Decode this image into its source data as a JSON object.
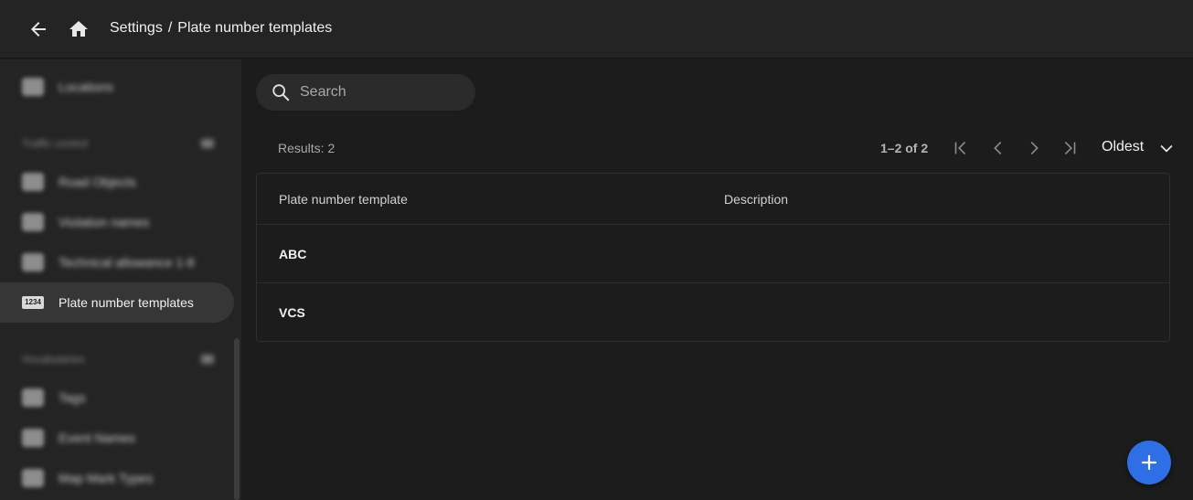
{
  "header": {
    "back_icon": "arrow-left-icon",
    "home_icon": "home-icon",
    "breadcrumb": {
      "parent": "Settings",
      "separator": "/",
      "current": "Plate number templates"
    }
  },
  "sidebar": {
    "items_top": [
      {
        "label": "Locations",
        "icon": "globe-icon"
      }
    ],
    "sections": [
      {
        "title": "Traffic control",
        "items": [
          {
            "label": "Road Objects",
            "icon": "road-object-icon"
          },
          {
            "label": "Violation names",
            "icon": "violation-icon"
          },
          {
            "label": "Technical allowance 1‑8",
            "icon": "allowance-icon"
          },
          {
            "label": "Plate number templates",
            "icon": "plate-icon",
            "active": true,
            "icon_text": "1234"
          }
        ]
      },
      {
        "title": "Vocabularies",
        "items": [
          {
            "label": "Tags",
            "icon": "tag-icon"
          },
          {
            "label": "Event Names",
            "icon": "event-icon"
          },
          {
            "label": "Map Mark Types",
            "icon": "map-mark-icon"
          }
        ]
      }
    ]
  },
  "search": {
    "placeholder": "Search",
    "value": ""
  },
  "toolbar": {
    "results": "Results: 2",
    "range": "1–2 of 2",
    "sort": "Oldest"
  },
  "table": {
    "columns": [
      "Plate number template",
      "Description"
    ],
    "rows": [
      {
        "template": "ABC",
        "description": ""
      },
      {
        "template": "VCS",
        "description": ""
      }
    ]
  },
  "fab": {
    "icon": "plus-icon"
  },
  "colors": {
    "accent": "#2f6fe6",
    "background": "#1c1c1c",
    "surface": "#242424"
  }
}
